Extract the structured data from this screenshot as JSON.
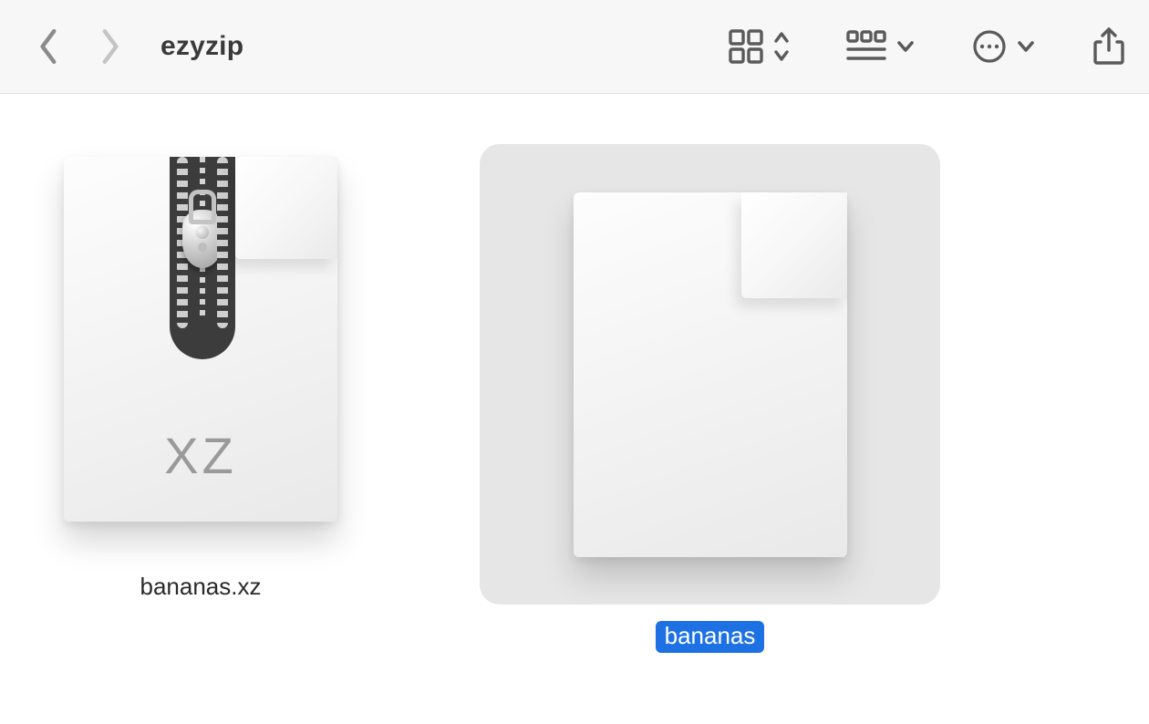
{
  "toolbar": {
    "folder_name": "ezyzip"
  },
  "files": [
    {
      "name": "bananas.xz",
      "badge": "XZ",
      "kind": "xz-archive",
      "selected": false
    },
    {
      "name": "bananas",
      "kind": "blank-document",
      "selected": true
    }
  ],
  "colors": {
    "selection_highlight": "#1d71e3",
    "selection_bg": "#e6e6e6"
  }
}
